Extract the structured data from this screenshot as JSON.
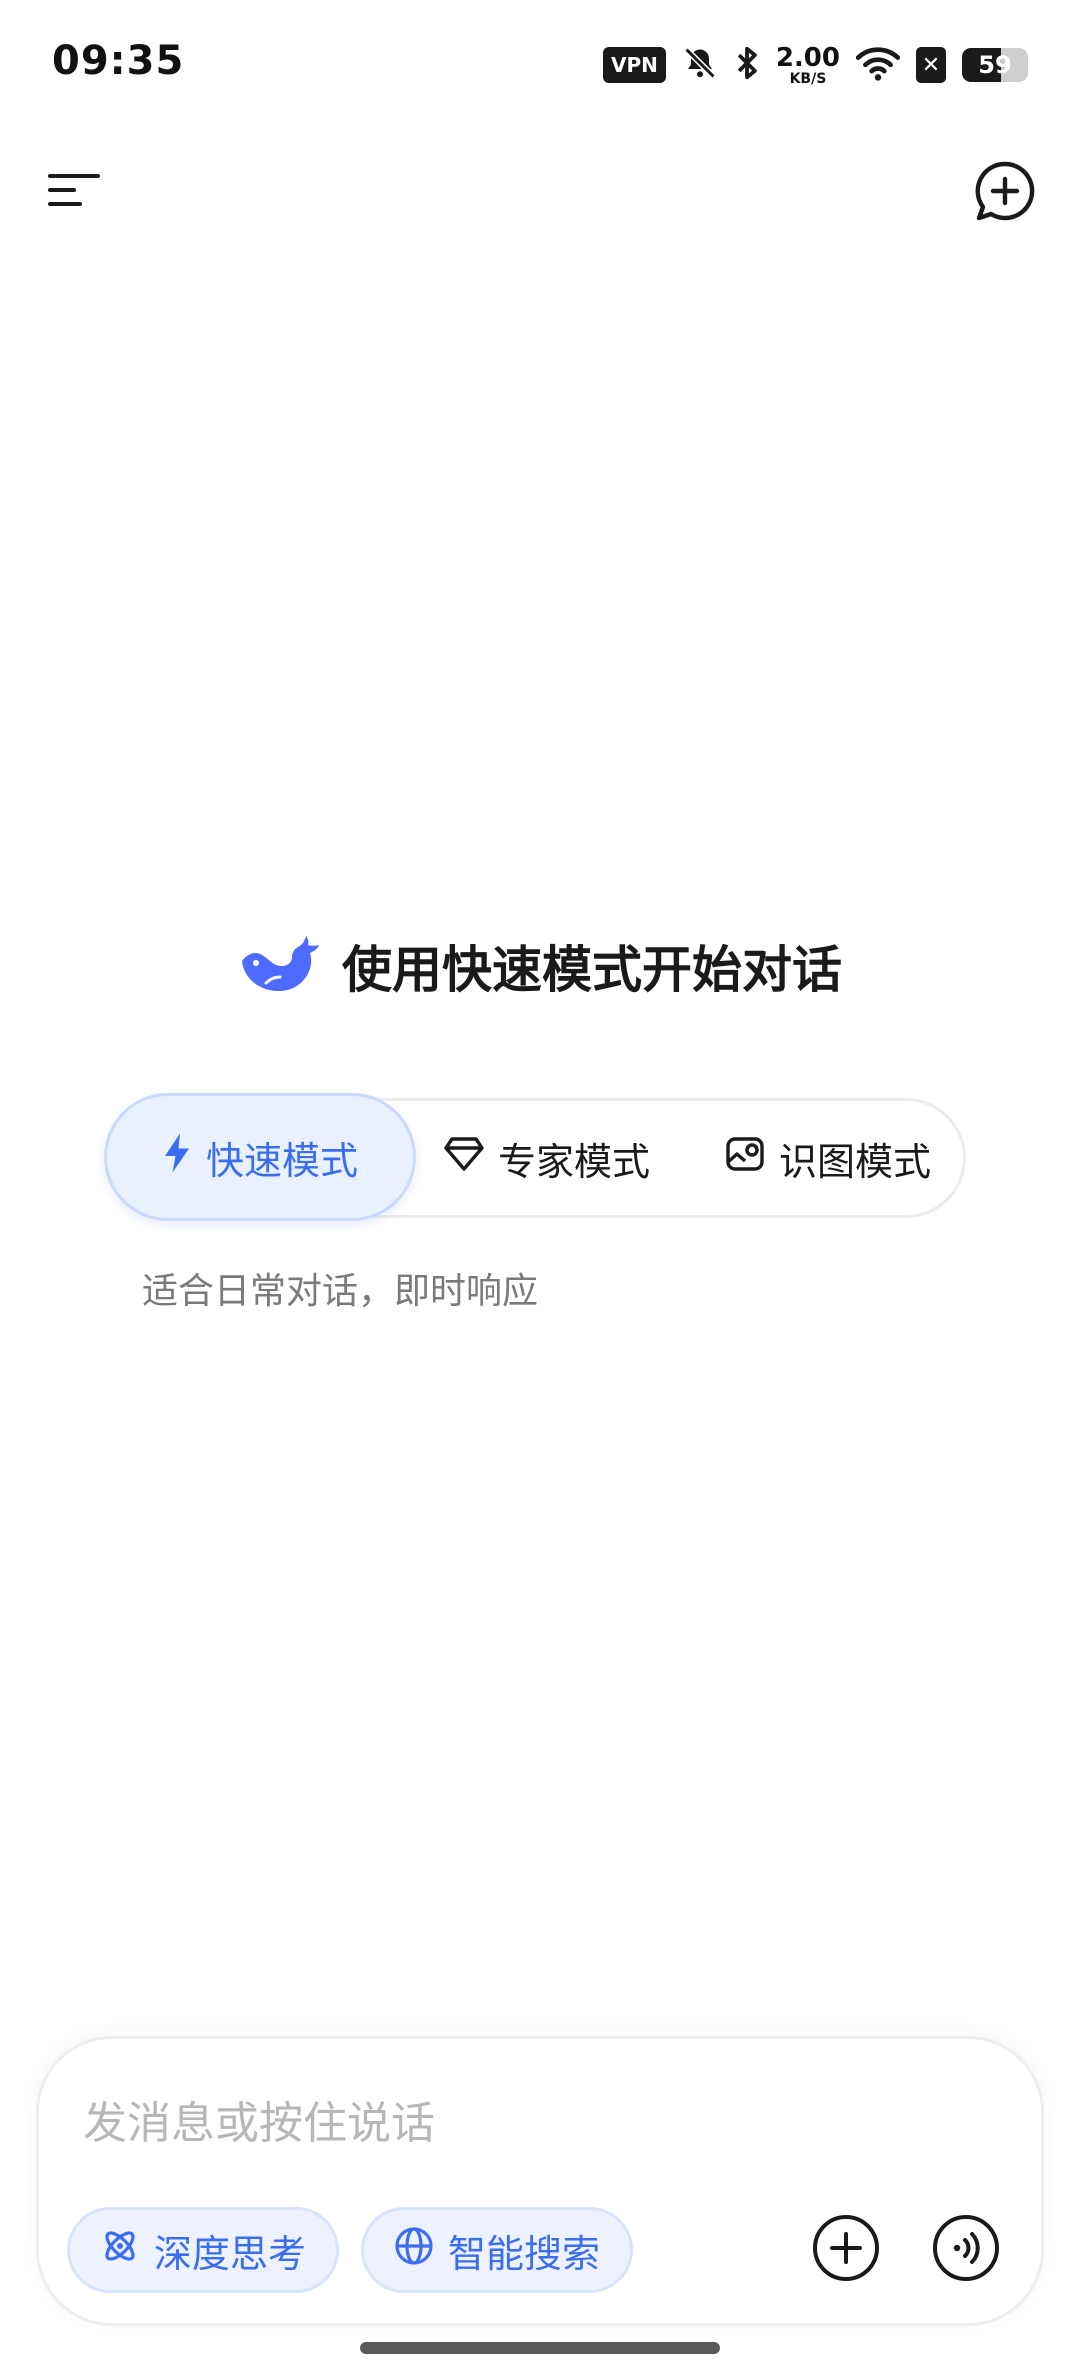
{
  "status_bar": {
    "time": "09:35",
    "vpn_label": "VPN",
    "net_speed_value": "2.00",
    "net_speed_unit": "KB/S",
    "battery_level": "59",
    "battery_fraction": 0.59,
    "icons": [
      "bell-off-icon",
      "bluetooth-icon",
      "wifi-icon",
      "sim-blocked-icon",
      "battery-icon"
    ]
  },
  "toolbar": {
    "menu_icon": "menu-icon",
    "new_chat_icon": "new-chat-icon"
  },
  "hero": {
    "title": "使用快速模式开始对话",
    "logo_icon": "whale-logo-icon"
  },
  "modes": {
    "items": [
      {
        "label": "快速模式",
        "icon": "lightning-icon",
        "selected": true
      },
      {
        "label": "专家模式",
        "icon": "diamond-icon",
        "selected": false
      },
      {
        "label": "识图模式",
        "icon": "image-icon",
        "selected": false
      }
    ],
    "description": "适合日常对话，即时响应"
  },
  "composer": {
    "placeholder": "发消息或按住说话",
    "deep_think_label": "深度思考",
    "smart_search_label": "智能搜索",
    "colors": {
      "accent": "#3a6df0",
      "pill_bg": "#edf2fe"
    }
  }
}
